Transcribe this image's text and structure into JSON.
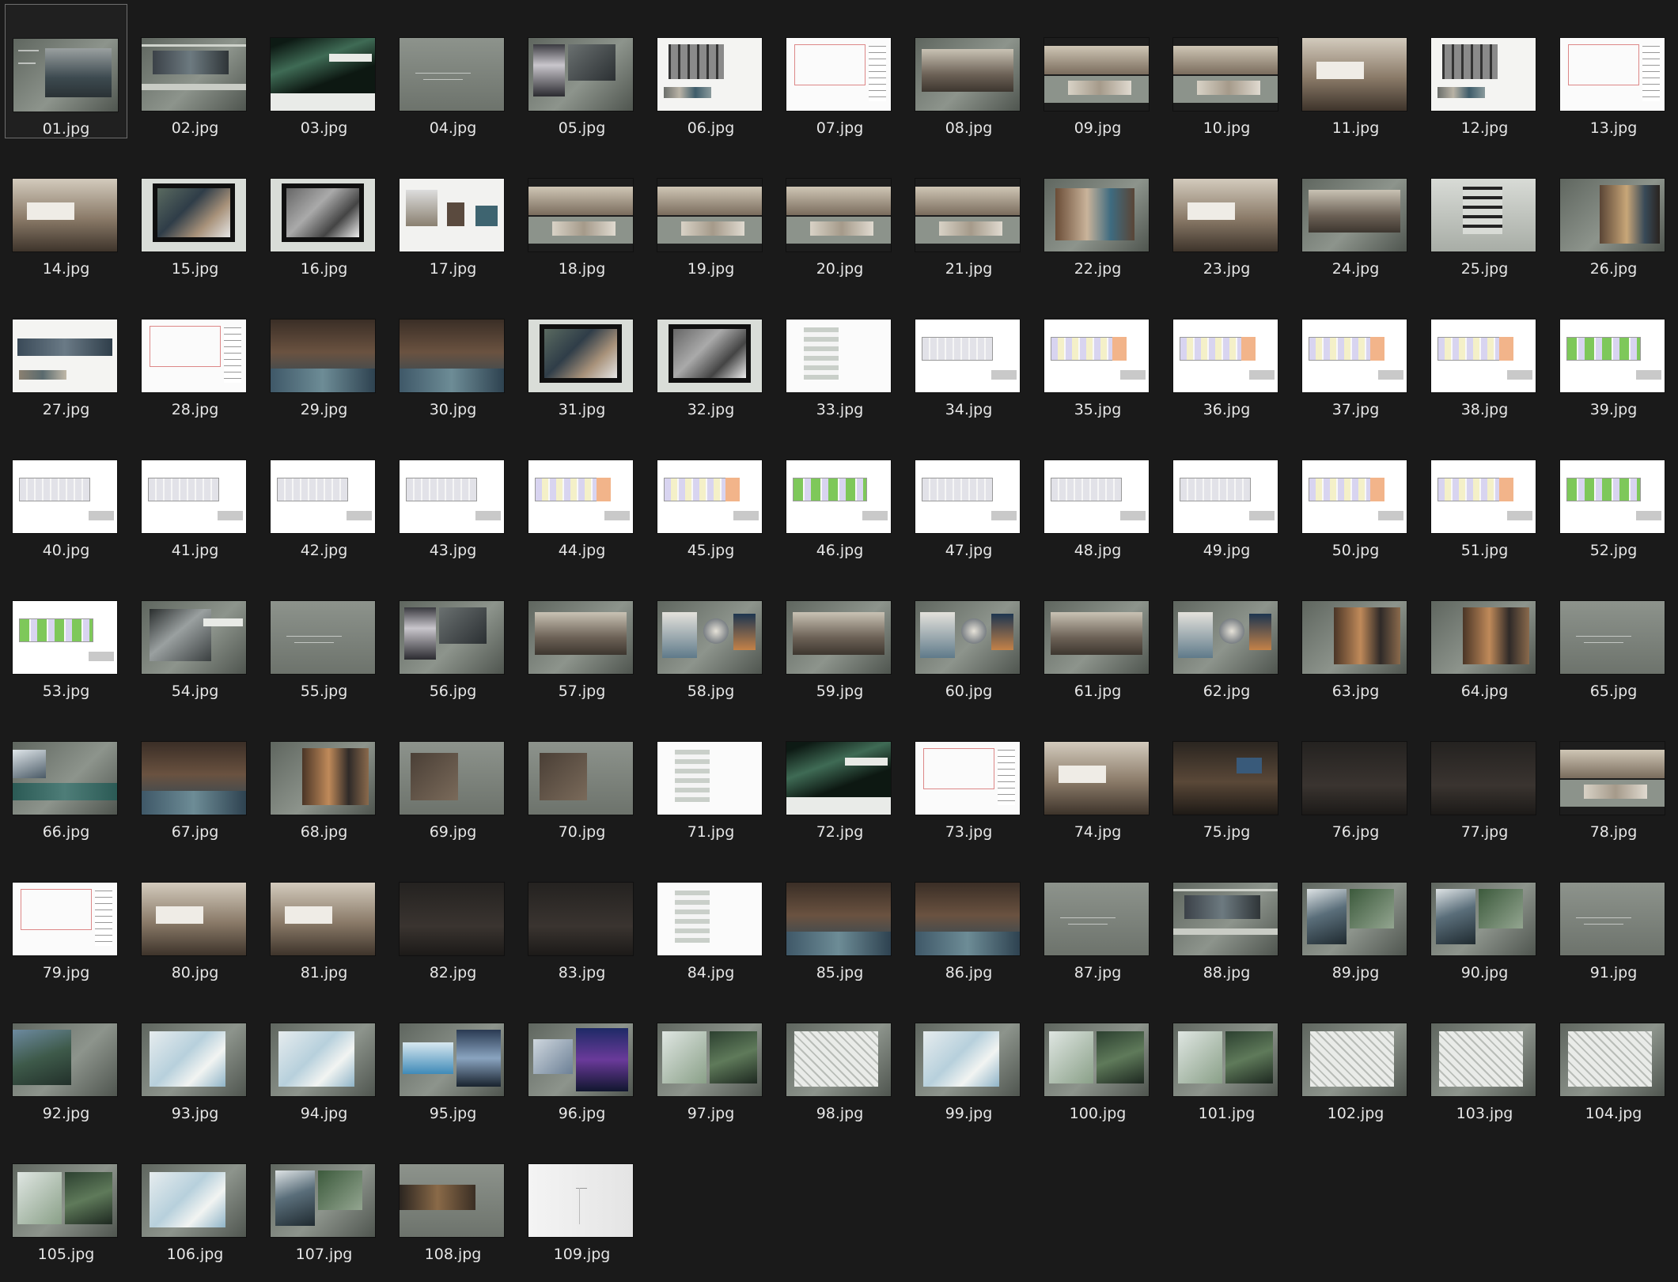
{
  "window": {
    "background": "#1a1a1a"
  },
  "files": [
    {
      "name": "01.jpg",
      "style": "cover",
      "selected": true
    },
    {
      "name": "02.jpg",
      "style": "location"
    },
    {
      "name": "03.jpg",
      "style": "aurora"
    },
    {
      "name": "04.jpg",
      "style": "gray"
    },
    {
      "name": "05.jpg",
      "style": "concept"
    },
    {
      "name": "06.jpg",
      "style": "plan"
    },
    {
      "name": "07.jpg",
      "style": "elevation"
    },
    {
      "name": "08.jpg",
      "style": "render"
    },
    {
      "name": "09.jpg",
      "style": "render-band"
    },
    {
      "name": "10.jpg",
      "style": "render-band"
    },
    {
      "name": "11.jpg",
      "style": "render-full"
    },
    {
      "name": "12.jpg",
      "style": "plan"
    },
    {
      "name": "13.jpg",
      "style": "elevation"
    },
    {
      "name": "14.jpg",
      "style": "render-full"
    },
    {
      "name": "15.jpg",
      "style": "material"
    },
    {
      "name": "16.jpg",
      "style": "material-bw"
    },
    {
      "name": "17.jpg",
      "style": "furniture"
    },
    {
      "name": "18.jpg",
      "style": "render-band"
    },
    {
      "name": "19.jpg",
      "style": "render-band"
    },
    {
      "name": "20.jpg",
      "style": "render-band"
    },
    {
      "name": "21.jpg",
      "style": "render-band"
    },
    {
      "name": "22.jpg",
      "style": "bathroom"
    },
    {
      "name": "23.jpg",
      "style": "render-full"
    },
    {
      "name": "24.jpg",
      "style": "render"
    },
    {
      "name": "25.jpg",
      "style": "furniture-gray"
    },
    {
      "name": "26.jpg",
      "style": "lobby"
    },
    {
      "name": "27.jpg",
      "style": "corridor-plan"
    },
    {
      "name": "28.jpg",
      "style": "elevation"
    },
    {
      "name": "29.jpg",
      "style": "corridor"
    },
    {
      "name": "30.jpg",
      "style": "corridor"
    },
    {
      "name": "31.jpg",
      "style": "material"
    },
    {
      "name": "32.jpg",
      "style": "material-bw"
    },
    {
      "name": "33.jpg",
      "style": "plan-white"
    },
    {
      "name": "34.jpg",
      "style": "floorplan"
    },
    {
      "name": "35.jpg",
      "style": "floorplan-color"
    },
    {
      "name": "36.jpg",
      "style": "floorplan-color"
    },
    {
      "name": "37.jpg",
      "style": "floorplan-color"
    },
    {
      "name": "38.jpg",
      "style": "floorplan-color"
    },
    {
      "name": "39.jpg",
      "style": "floorplan-green"
    },
    {
      "name": "40.jpg",
      "style": "floorplan"
    },
    {
      "name": "41.jpg",
      "style": "floorplan"
    },
    {
      "name": "42.jpg",
      "style": "floorplan"
    },
    {
      "name": "43.jpg",
      "style": "floorplan"
    },
    {
      "name": "44.jpg",
      "style": "floorplan-color"
    },
    {
      "name": "45.jpg",
      "style": "floorplan-color"
    },
    {
      "name": "46.jpg",
      "style": "floorplan-green"
    },
    {
      "name": "47.jpg",
      "style": "floorplan"
    },
    {
      "name": "48.jpg",
      "style": "floorplan"
    },
    {
      "name": "49.jpg",
      "style": "floorplan"
    },
    {
      "name": "50.jpg",
      "style": "floorplan-color"
    },
    {
      "name": "51.jpg",
      "style": "floorplan-color"
    },
    {
      "name": "52.jpg",
      "style": "floorplan-green"
    },
    {
      "name": "53.jpg",
      "style": "floorplan-green"
    },
    {
      "name": "54.jpg",
      "style": "aurora-dark"
    },
    {
      "name": "55.jpg",
      "style": "gray"
    },
    {
      "name": "56.jpg",
      "style": "concept"
    },
    {
      "name": "57.jpg",
      "style": "render"
    },
    {
      "name": "58.jpg",
      "style": "detail"
    },
    {
      "name": "59.jpg",
      "style": "render"
    },
    {
      "name": "60.jpg",
      "style": "detail"
    },
    {
      "name": "61.jpg",
      "style": "render"
    },
    {
      "name": "62.jpg",
      "style": "detail"
    },
    {
      "name": "63.jpg",
      "style": "signage"
    },
    {
      "name": "64.jpg",
      "style": "signage"
    },
    {
      "name": "65.jpg",
      "style": "gray"
    },
    {
      "name": "66.jpg",
      "style": "sign-numbers"
    },
    {
      "name": "67.jpg",
      "style": "corridor"
    },
    {
      "name": "68.jpg",
      "style": "signage"
    },
    {
      "name": "69.jpg",
      "style": "gray-sign"
    },
    {
      "name": "70.jpg",
      "style": "gray-sign"
    },
    {
      "name": "71.jpg",
      "style": "plan-white"
    },
    {
      "name": "72.jpg",
      "style": "aurora"
    },
    {
      "name": "73.jpg",
      "style": "elevation"
    },
    {
      "name": "74.jpg",
      "style": "render-full"
    },
    {
      "name": "75.jpg",
      "style": "render-dark"
    },
    {
      "name": "76.jpg",
      "style": "dark"
    },
    {
      "name": "77.jpg",
      "style": "dark"
    },
    {
      "name": "78.jpg",
      "style": "render-band"
    },
    {
      "name": "79.jpg",
      "style": "elevation"
    },
    {
      "name": "80.jpg",
      "style": "render-full"
    },
    {
      "name": "81.jpg",
      "style": "render-full"
    },
    {
      "name": "82.jpg",
      "style": "dark"
    },
    {
      "name": "83.jpg",
      "style": "dark"
    },
    {
      "name": "84.jpg",
      "style": "plan-white"
    },
    {
      "name": "85.jpg",
      "style": "corridor"
    },
    {
      "name": "86.jpg",
      "style": "corridor"
    },
    {
      "name": "87.jpg",
      "style": "gray"
    },
    {
      "name": "88.jpg",
      "style": "location"
    },
    {
      "name": "89.jpg",
      "style": "concept-arch"
    },
    {
      "name": "90.jpg",
      "style": "concept-arch"
    },
    {
      "name": "91.jpg",
      "style": "gray"
    },
    {
      "name": "92.jpg",
      "style": "aerial"
    },
    {
      "name": "93.jpg",
      "style": "site-plan"
    },
    {
      "name": "94.jpg",
      "style": "site-plan"
    },
    {
      "name": "95.jpg",
      "style": "pool"
    },
    {
      "name": "96.jpg",
      "style": "bar"
    },
    {
      "name": "97.jpg",
      "style": "island"
    },
    {
      "name": "98.jpg",
      "style": "site-plan-gray"
    },
    {
      "name": "99.jpg",
      "style": "site-plan"
    },
    {
      "name": "100.jpg",
      "style": "island"
    },
    {
      "name": "101.jpg",
      "style": "island"
    },
    {
      "name": "102.jpg",
      "style": "site-plan-gray"
    },
    {
      "name": "103.jpg",
      "style": "site-plan-gray"
    },
    {
      "name": "104.jpg",
      "style": "site-plan-gray"
    },
    {
      "name": "105.jpg",
      "style": "island"
    },
    {
      "name": "106.jpg",
      "style": "site-plan"
    },
    {
      "name": "107.jpg",
      "style": "concept-arch"
    },
    {
      "name": "108.jpg",
      "style": "gray-wood"
    },
    {
      "name": "109.jpg",
      "style": "white"
    }
  ]
}
